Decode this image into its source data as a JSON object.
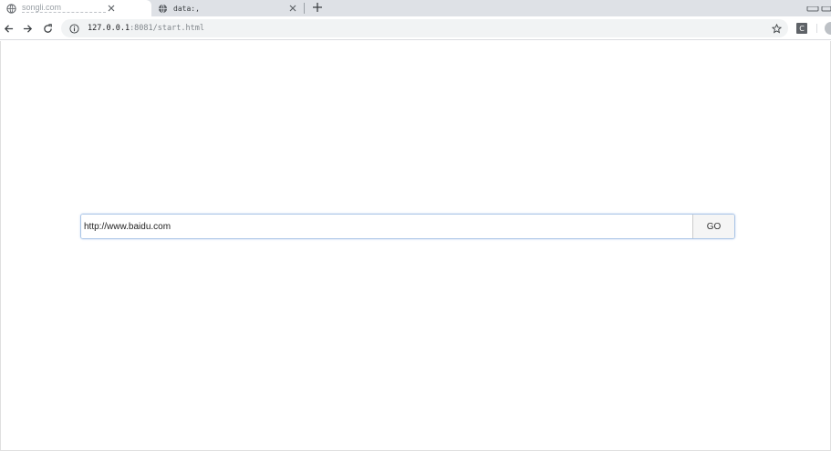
{
  "tabs": [
    {
      "title": "songli.com",
      "active": true
    },
    {
      "title": "data:,",
      "active": false
    }
  ],
  "omnibox": {
    "url_host": "127.0.0.1",
    "url_rest": ":8081/start.html"
  },
  "extension": {
    "label": "C"
  },
  "form": {
    "url_value": "http://www.baidu.com",
    "go_label": "GO"
  },
  "colors": {
    "tabstrip": "#dee1e6",
    "omnibox_bg": "#f1f3f4",
    "input_border": "#a9c4e6"
  }
}
